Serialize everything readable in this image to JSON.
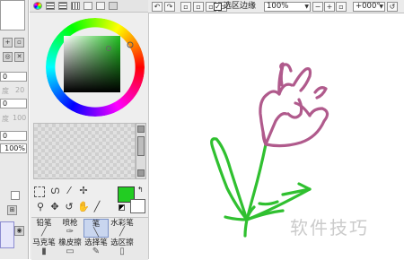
{
  "left_strip": {
    "value_boxes": [
      "0",
      "0",
      "0"
    ],
    "ghost_labels": [
      "度",
      "20",
      "度",
      "100"
    ],
    "percent": "100%"
  },
  "color_panel": {
    "tabs": [
      "color-wheel",
      "rgb-sliders",
      "hsv-sliders",
      "swatches",
      "scratchpad",
      "user-palette"
    ],
    "wheel": {
      "hue_ring": true,
      "square_hue_color": "#20c020"
    }
  },
  "tool_panel": {
    "tools": [
      "rect-select",
      "lasso",
      "magic-wand",
      "zoom",
      "pan",
      "rotate",
      "hand",
      "eyedropper"
    ],
    "primary_color": "#22cc22",
    "secondary_color": "#ffffff",
    "brushes": [
      {
        "label": "铅笔",
        "icon": "pencil-icon"
      },
      {
        "label": "喷枪",
        "icon": "airbrush-icon"
      },
      {
        "label": "笔",
        "icon": "pen-icon",
        "selected": true
      },
      {
        "label": "水彩笔",
        "icon": "watercolor-icon"
      },
      {
        "label": "马克笔",
        "icon": "marker-icon"
      },
      {
        "label": "橡皮擦",
        "icon": "eraser-icon"
      },
      {
        "label": "选择笔",
        "icon": "select-pen-icon"
      },
      {
        "label": "选区擦",
        "icon": "select-eraser-icon"
      }
    ]
  },
  "toolbar": {
    "selection_edge_checked": true,
    "selection_edge_label": "选区边缘",
    "zoom_value": "100%",
    "rotation_value": "+000°"
  },
  "canvas": {
    "drawing": "tulip sketch",
    "petal_color": "#b05a8c",
    "stem_color": "#30c030",
    "watermark": "软件技巧"
  }
}
